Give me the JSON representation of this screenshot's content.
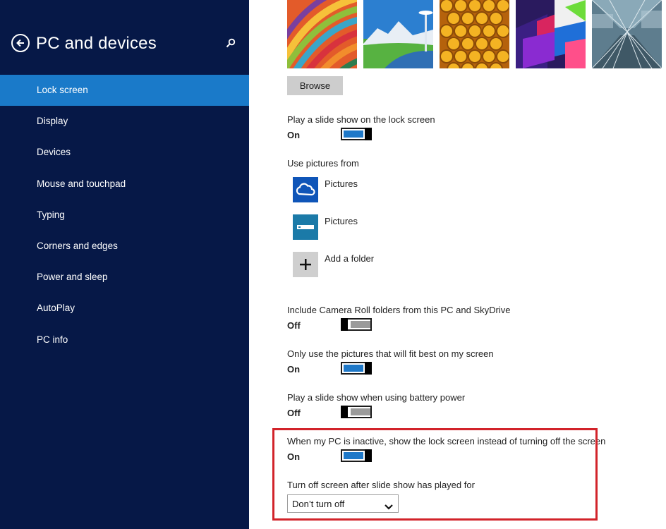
{
  "nav": {
    "title": "PC and devices",
    "back_icon": "back-arrow-icon",
    "search_icon": "search-icon",
    "items": [
      {
        "label": "Lock screen",
        "selected": true
      },
      {
        "label": "Display"
      },
      {
        "label": "Devices"
      },
      {
        "label": "Mouse and touchpad"
      },
      {
        "label": "Typing"
      },
      {
        "label": "Corners and edges"
      },
      {
        "label": "Power and sleep"
      },
      {
        "label": "AutoPlay"
      },
      {
        "label": "PC info"
      }
    ],
    "background_color": "#061847",
    "selected_color": "#1a7ac9"
  },
  "lock_screen": {
    "thumbnails": [
      "colorful-stripes",
      "space-needle-mountain",
      "honeycomb",
      "color-prisms",
      "light-tunnel"
    ],
    "browse_label": "Browse",
    "settings": {
      "slideshow": {
        "label": "Play a slide show on the lock screen",
        "state": "On",
        "on": true
      },
      "use_pictures_from": {
        "label": "Use pictures from",
        "sources": [
          {
            "label": "Pictures",
            "icon": "skydrive-cloud-icon"
          },
          {
            "label": "Pictures",
            "icon": "drive-icon"
          },
          {
            "label": "Add a folder",
            "icon": "plus-icon"
          }
        ]
      },
      "camera_roll": {
        "label": "Include Camera Roll folders from this PC and SkyDrive",
        "state": "Off",
        "on": false
      },
      "best_fit": {
        "label": "Only use the pictures that will fit best on my screen",
        "state": "On",
        "on": true
      },
      "battery": {
        "label": "Play a slide show when using battery power",
        "state": "Off",
        "on": false
      },
      "inactive": {
        "label": "When my PC is inactive, show the lock screen instead of turning off the screen",
        "state": "On",
        "on": true
      },
      "turn_off_screen": {
        "label": "Turn off screen after slide show has played for",
        "value": "Don’t turn off"
      }
    },
    "accent_color": "#1e78c8",
    "highlight_color": "#d2232a"
  }
}
